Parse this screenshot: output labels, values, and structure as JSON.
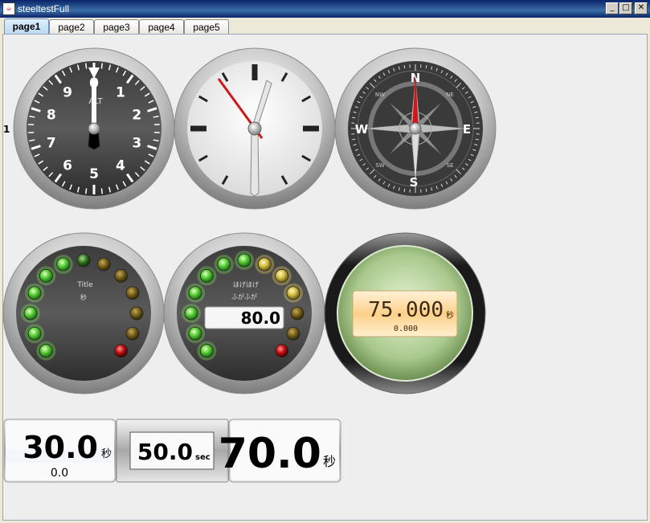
{
  "window": {
    "title": "steeltestFull",
    "minimize": "_",
    "maximize": "□",
    "close": "✕"
  },
  "tabs": [
    {
      "label": "page1",
      "active": true
    },
    {
      "label": "page2",
      "active": false
    },
    {
      "label": "page3",
      "active": false
    },
    {
      "label": "page4",
      "active": false
    },
    {
      "label": "page5",
      "active": false
    }
  ],
  "side_label": "1",
  "altimeter": {
    "label": "ALT",
    "numbers": [
      "0",
      "1",
      "2",
      "3",
      "4",
      "5",
      "6",
      "7",
      "8",
      "9"
    ]
  },
  "compass": {
    "cardinals": {
      "n": "N",
      "e": "E",
      "s": "S",
      "w": "W"
    },
    "intercardinals": {
      "ne": "NE",
      "se": "SE",
      "sw": "SW",
      "nw": "NW"
    }
  },
  "led_gauge_1": {
    "title": "Title",
    "unit": "秒"
  },
  "led_gauge_2": {
    "title": "ほげほげ",
    "unit": "ふがふが",
    "value": "80.0"
  },
  "lcd_gauge": {
    "value": "75.000",
    "unit": "秒",
    "sub": "0.000"
  },
  "display_1": {
    "value": "30.0",
    "unit": "秒",
    "sub": "0.0"
  },
  "display_2": {
    "value": "50.0",
    "unit": "sec"
  },
  "display_3": {
    "value": "70.0",
    "unit": "秒"
  }
}
